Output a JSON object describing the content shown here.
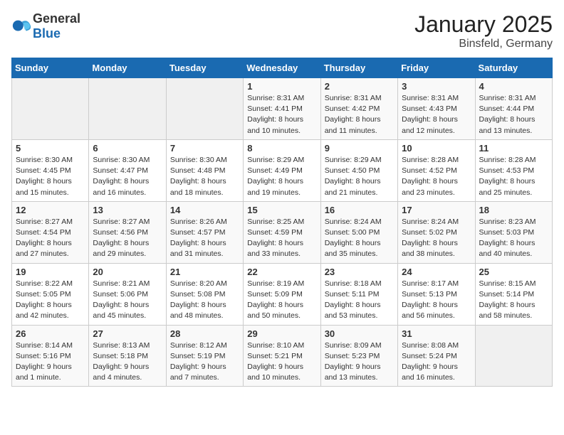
{
  "header": {
    "logo_general": "General",
    "logo_blue": "Blue",
    "title": "January 2025",
    "subtitle": "Binsfeld, Germany"
  },
  "days_of_week": [
    "Sunday",
    "Monday",
    "Tuesday",
    "Wednesday",
    "Thursday",
    "Friday",
    "Saturday"
  ],
  "weeks": [
    [
      {
        "day": "",
        "sunrise": "",
        "sunset": "",
        "daylight": "",
        "empty": true
      },
      {
        "day": "",
        "sunrise": "",
        "sunset": "",
        "daylight": "",
        "empty": true
      },
      {
        "day": "",
        "sunrise": "",
        "sunset": "",
        "daylight": "",
        "empty": true
      },
      {
        "day": "1",
        "sunrise": "Sunrise: 8:31 AM",
        "sunset": "Sunset: 4:41 PM",
        "daylight": "Daylight: 8 hours and 10 minutes.",
        "empty": false
      },
      {
        "day": "2",
        "sunrise": "Sunrise: 8:31 AM",
        "sunset": "Sunset: 4:42 PM",
        "daylight": "Daylight: 8 hours and 11 minutes.",
        "empty": false
      },
      {
        "day": "3",
        "sunrise": "Sunrise: 8:31 AM",
        "sunset": "Sunset: 4:43 PM",
        "daylight": "Daylight: 8 hours and 12 minutes.",
        "empty": false
      },
      {
        "day": "4",
        "sunrise": "Sunrise: 8:31 AM",
        "sunset": "Sunset: 4:44 PM",
        "daylight": "Daylight: 8 hours and 13 minutes.",
        "empty": false
      }
    ],
    [
      {
        "day": "5",
        "sunrise": "Sunrise: 8:30 AM",
        "sunset": "Sunset: 4:45 PM",
        "daylight": "Daylight: 8 hours and 15 minutes.",
        "empty": false
      },
      {
        "day": "6",
        "sunrise": "Sunrise: 8:30 AM",
        "sunset": "Sunset: 4:47 PM",
        "daylight": "Daylight: 8 hours and 16 minutes.",
        "empty": false
      },
      {
        "day": "7",
        "sunrise": "Sunrise: 8:30 AM",
        "sunset": "Sunset: 4:48 PM",
        "daylight": "Daylight: 8 hours and 18 minutes.",
        "empty": false
      },
      {
        "day": "8",
        "sunrise": "Sunrise: 8:29 AM",
        "sunset": "Sunset: 4:49 PM",
        "daylight": "Daylight: 8 hours and 19 minutes.",
        "empty": false
      },
      {
        "day": "9",
        "sunrise": "Sunrise: 8:29 AM",
        "sunset": "Sunset: 4:50 PM",
        "daylight": "Daylight: 8 hours and 21 minutes.",
        "empty": false
      },
      {
        "day": "10",
        "sunrise": "Sunrise: 8:28 AM",
        "sunset": "Sunset: 4:52 PM",
        "daylight": "Daylight: 8 hours and 23 minutes.",
        "empty": false
      },
      {
        "day": "11",
        "sunrise": "Sunrise: 8:28 AM",
        "sunset": "Sunset: 4:53 PM",
        "daylight": "Daylight: 8 hours and 25 minutes.",
        "empty": false
      }
    ],
    [
      {
        "day": "12",
        "sunrise": "Sunrise: 8:27 AM",
        "sunset": "Sunset: 4:54 PM",
        "daylight": "Daylight: 8 hours and 27 minutes.",
        "empty": false
      },
      {
        "day": "13",
        "sunrise": "Sunrise: 8:27 AM",
        "sunset": "Sunset: 4:56 PM",
        "daylight": "Daylight: 8 hours and 29 minutes.",
        "empty": false
      },
      {
        "day": "14",
        "sunrise": "Sunrise: 8:26 AM",
        "sunset": "Sunset: 4:57 PM",
        "daylight": "Daylight: 8 hours and 31 minutes.",
        "empty": false
      },
      {
        "day": "15",
        "sunrise": "Sunrise: 8:25 AM",
        "sunset": "Sunset: 4:59 PM",
        "daylight": "Daylight: 8 hours and 33 minutes.",
        "empty": false
      },
      {
        "day": "16",
        "sunrise": "Sunrise: 8:24 AM",
        "sunset": "Sunset: 5:00 PM",
        "daylight": "Daylight: 8 hours and 35 minutes.",
        "empty": false
      },
      {
        "day": "17",
        "sunrise": "Sunrise: 8:24 AM",
        "sunset": "Sunset: 5:02 PM",
        "daylight": "Daylight: 8 hours and 38 minutes.",
        "empty": false
      },
      {
        "day": "18",
        "sunrise": "Sunrise: 8:23 AM",
        "sunset": "Sunset: 5:03 PM",
        "daylight": "Daylight: 8 hours and 40 minutes.",
        "empty": false
      }
    ],
    [
      {
        "day": "19",
        "sunrise": "Sunrise: 8:22 AM",
        "sunset": "Sunset: 5:05 PM",
        "daylight": "Daylight: 8 hours and 42 minutes.",
        "empty": false
      },
      {
        "day": "20",
        "sunrise": "Sunrise: 8:21 AM",
        "sunset": "Sunset: 5:06 PM",
        "daylight": "Daylight: 8 hours and 45 minutes.",
        "empty": false
      },
      {
        "day": "21",
        "sunrise": "Sunrise: 8:20 AM",
        "sunset": "Sunset: 5:08 PM",
        "daylight": "Daylight: 8 hours and 48 minutes.",
        "empty": false
      },
      {
        "day": "22",
        "sunrise": "Sunrise: 8:19 AM",
        "sunset": "Sunset: 5:09 PM",
        "daylight": "Daylight: 8 hours and 50 minutes.",
        "empty": false
      },
      {
        "day": "23",
        "sunrise": "Sunrise: 8:18 AM",
        "sunset": "Sunset: 5:11 PM",
        "daylight": "Daylight: 8 hours and 53 minutes.",
        "empty": false
      },
      {
        "day": "24",
        "sunrise": "Sunrise: 8:17 AM",
        "sunset": "Sunset: 5:13 PM",
        "daylight": "Daylight: 8 hours and 56 minutes.",
        "empty": false
      },
      {
        "day": "25",
        "sunrise": "Sunrise: 8:15 AM",
        "sunset": "Sunset: 5:14 PM",
        "daylight": "Daylight: 8 hours and 58 minutes.",
        "empty": false
      }
    ],
    [
      {
        "day": "26",
        "sunrise": "Sunrise: 8:14 AM",
        "sunset": "Sunset: 5:16 PM",
        "daylight": "Daylight: 9 hours and 1 minute.",
        "empty": false
      },
      {
        "day": "27",
        "sunrise": "Sunrise: 8:13 AM",
        "sunset": "Sunset: 5:18 PM",
        "daylight": "Daylight: 9 hours and 4 minutes.",
        "empty": false
      },
      {
        "day": "28",
        "sunrise": "Sunrise: 8:12 AM",
        "sunset": "Sunset: 5:19 PM",
        "daylight": "Daylight: 9 hours and 7 minutes.",
        "empty": false
      },
      {
        "day": "29",
        "sunrise": "Sunrise: 8:10 AM",
        "sunset": "Sunset: 5:21 PM",
        "daylight": "Daylight: 9 hours and 10 minutes.",
        "empty": false
      },
      {
        "day": "30",
        "sunrise": "Sunrise: 8:09 AM",
        "sunset": "Sunset: 5:23 PM",
        "daylight": "Daylight: 9 hours and 13 minutes.",
        "empty": false
      },
      {
        "day": "31",
        "sunrise": "Sunrise: 8:08 AM",
        "sunset": "Sunset: 5:24 PM",
        "daylight": "Daylight: 9 hours and 16 minutes.",
        "empty": false
      },
      {
        "day": "",
        "sunrise": "",
        "sunset": "",
        "daylight": "",
        "empty": true
      }
    ]
  ]
}
